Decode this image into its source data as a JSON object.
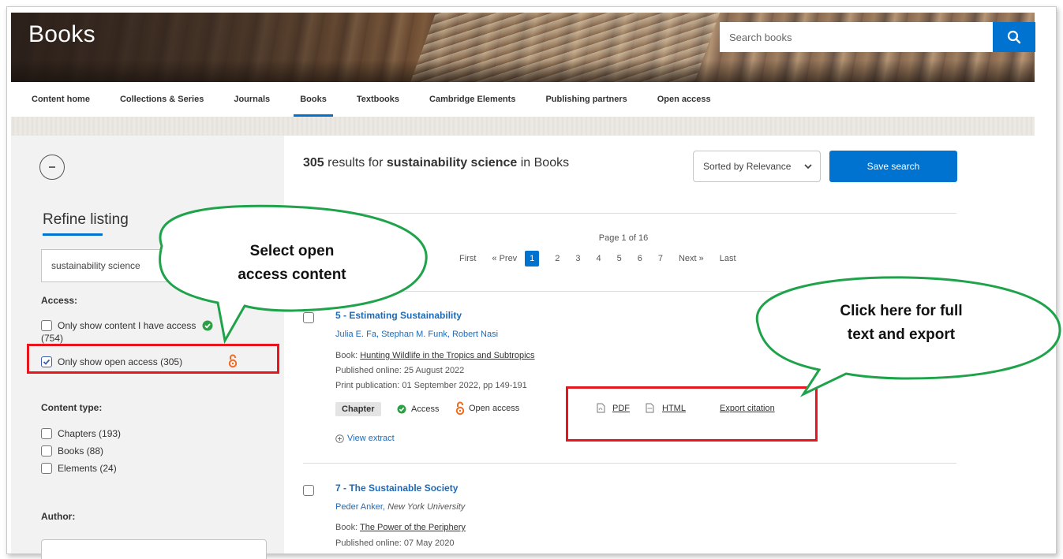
{
  "banner": {
    "title": "Books",
    "search_placeholder": "Search books"
  },
  "nav": {
    "items": [
      {
        "label": "Content home"
      },
      {
        "label": "Collections & Series"
      },
      {
        "label": "Journals"
      },
      {
        "label": "Books",
        "active": true
      },
      {
        "label": "Textbooks"
      },
      {
        "label": "Cambridge Elements"
      },
      {
        "label": "Publishing partners"
      },
      {
        "label": "Open access"
      }
    ]
  },
  "sidebar": {
    "refine_title": "Refine listing",
    "refine_value": "sustainability science",
    "access_heading": "Access:",
    "access_options": [
      {
        "label": "Only show content I have access",
        "label_line2": "(754)",
        "checked": false
      },
      {
        "label": "Only show open access (305)",
        "checked": true
      }
    ],
    "content_type_heading": "Content type:",
    "content_types": [
      {
        "label": "Chapters (193)"
      },
      {
        "label": "Books (88)"
      },
      {
        "label": "Elements (24)"
      }
    ],
    "author_heading": "Author:"
  },
  "results": {
    "count": "305",
    "text_mid": "results for",
    "query": "sustainability science",
    "text_end": "in Books",
    "sort_label": "Sorted by Relevance",
    "save_label": "Save search",
    "page_label": "Page 1 of 16",
    "pager": {
      "first": "First",
      "prev": "« Prev",
      "current": "1",
      "pages": [
        "2",
        "3",
        "4",
        "5",
        "6",
        "7"
      ],
      "next": "Next »",
      "last": "Last"
    },
    "items": [
      {
        "title": "5 - Estimating Sustainability",
        "authors": "Julia E. Fa, Stephan M. Funk, Robert Nasi",
        "book_prefix": "Book:",
        "book_title": "Hunting Wildlife in the Tropics and Subtropics",
        "published_online": "Published online: 25 August 2022",
        "print_publication": "Print publication: 01 September 2022, pp 149-191",
        "type_badge": "Chapter",
        "access_label": "Access",
        "oa_label": "Open access",
        "pdf_label": "PDF",
        "html_label": "HTML",
        "export_label": "Export citation",
        "view_extract": "View extract"
      },
      {
        "title": "7 - The Sustainable Society",
        "author_name": "Peder Anker,",
        "author_affiliation": "New York University",
        "book_prefix": "Book:",
        "book_title": "The Power of the Periphery",
        "published_online": "Published online: 07 May 2020"
      }
    ]
  },
  "annotations": {
    "bubble_left": {
      "line1": "Select open",
      "line2": "access content"
    },
    "bubble_right": {
      "line1": "Click here for full",
      "line2": "text and  export"
    }
  },
  "colors": {
    "accent": "#0072cf",
    "annotation_red": "#e8151d",
    "bubble_green": "#1fa34a",
    "oa_orange": "#f06b1f",
    "access_green": "#2e9e47"
  }
}
